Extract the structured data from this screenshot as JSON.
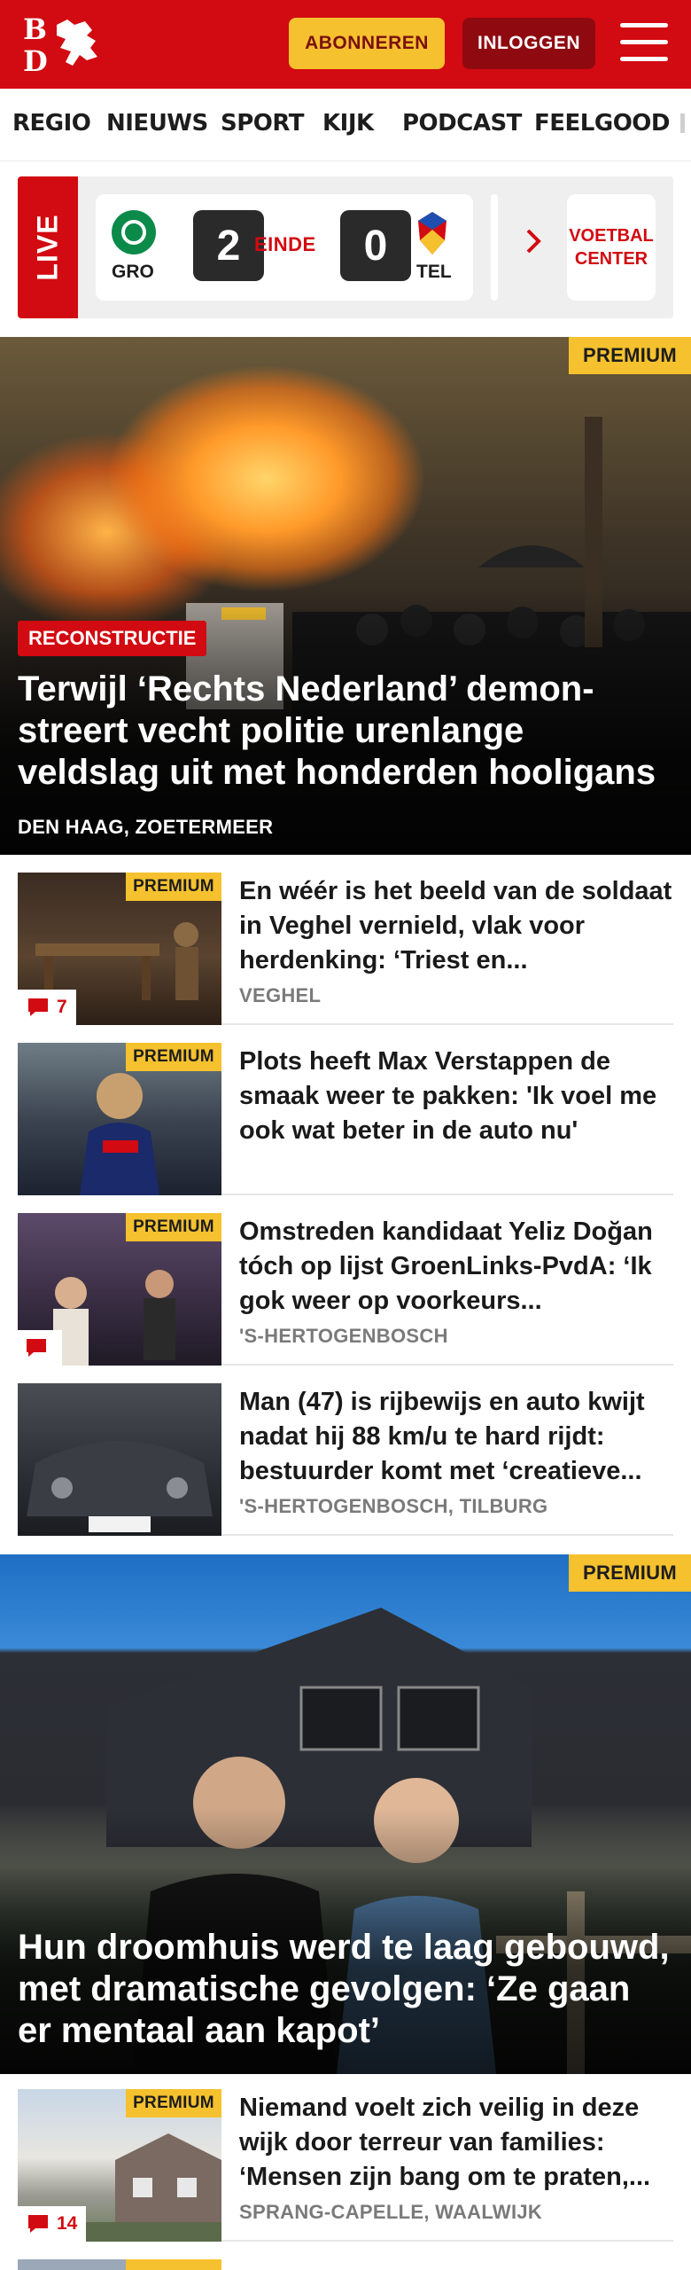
{
  "header": {
    "logo_text": "BD",
    "subscribe_label": "ABONNEREN",
    "login_label": "INLOGGEN",
    "menu_icon": "hamburger-icon",
    "brand_color": "#d20a11"
  },
  "nav": {
    "items": [
      "REGIO",
      "NIEUWS",
      "SPORT",
      "KIJK",
      "PODCAST",
      "FEELGOOD"
    ]
  },
  "live": {
    "label": "LIVE",
    "home_team": "GRO",
    "home_score": "2",
    "status": "EINDE",
    "away_score": "0",
    "away_team": "TEL",
    "center_label_1": "VOETBAL",
    "center_label_2": "CENTER"
  },
  "hero1": {
    "badge": "PREMIUM",
    "tag": "RECONSTRUCTIE",
    "title": "Terwijl ‘Rechts Nederland’ demon­streert vecht politie urenlange veldslag uit met honderden hooligans",
    "location": "DEN HAAG, ZOETERMEER"
  },
  "articles": [
    {
      "badge": "PREMIUM",
      "title": "En wéér is het beeld van de soldaat in Veghel vernield, vlak voor herdenking: ‘Triest en...",
      "location": "VEGHEL",
      "comments": "7"
    },
    {
      "badge": "PREMIUM",
      "title": "Plots heeft Max Verstappen de smaak weer te pakken: 'Ik voel me ook wat beter in de auto nu'",
      "location": "",
      "comments": ""
    },
    {
      "badge": "PREMIUM",
      "title": "Omstreden kandidaat Yeliz Doğan tóch op lijst GroenLinks-PvdA: ‘Ik gok weer op voorkeurs...",
      "location": "'S-HERTOGENBOSCH",
      "comments": ""
    },
    {
      "badge": "",
      "title": "Man (47) is rijbewijs en auto kwijt nadat hij 88 km/u te hard rijdt: bestuurder komt met ‘creatieve...",
      "location": "'S-HERTOGENBOSCH, TILBURG",
      "comments": ""
    }
  ],
  "hero2": {
    "badge": "PREMIUM",
    "title": "Hun droomhuis werd te laag gebouwd, met dramatische gevolgen: ‘Ze gaan er mentaal aan kapot’"
  },
  "articles2": [
    {
      "badge": "PREMIUM",
      "title": "Niemand voelt zich veilig in deze wijk door terreur van families: ‘Mensen zijn bang om te praten,...",
      "location": "SPRANG-CAPELLE, WAALWIJK",
      "comments": "14"
    }
  ],
  "colors": {
    "premium": "#f5c12e",
    "dark_red": "#8f0a10",
    "meta_gray": "#7a7a7a"
  }
}
